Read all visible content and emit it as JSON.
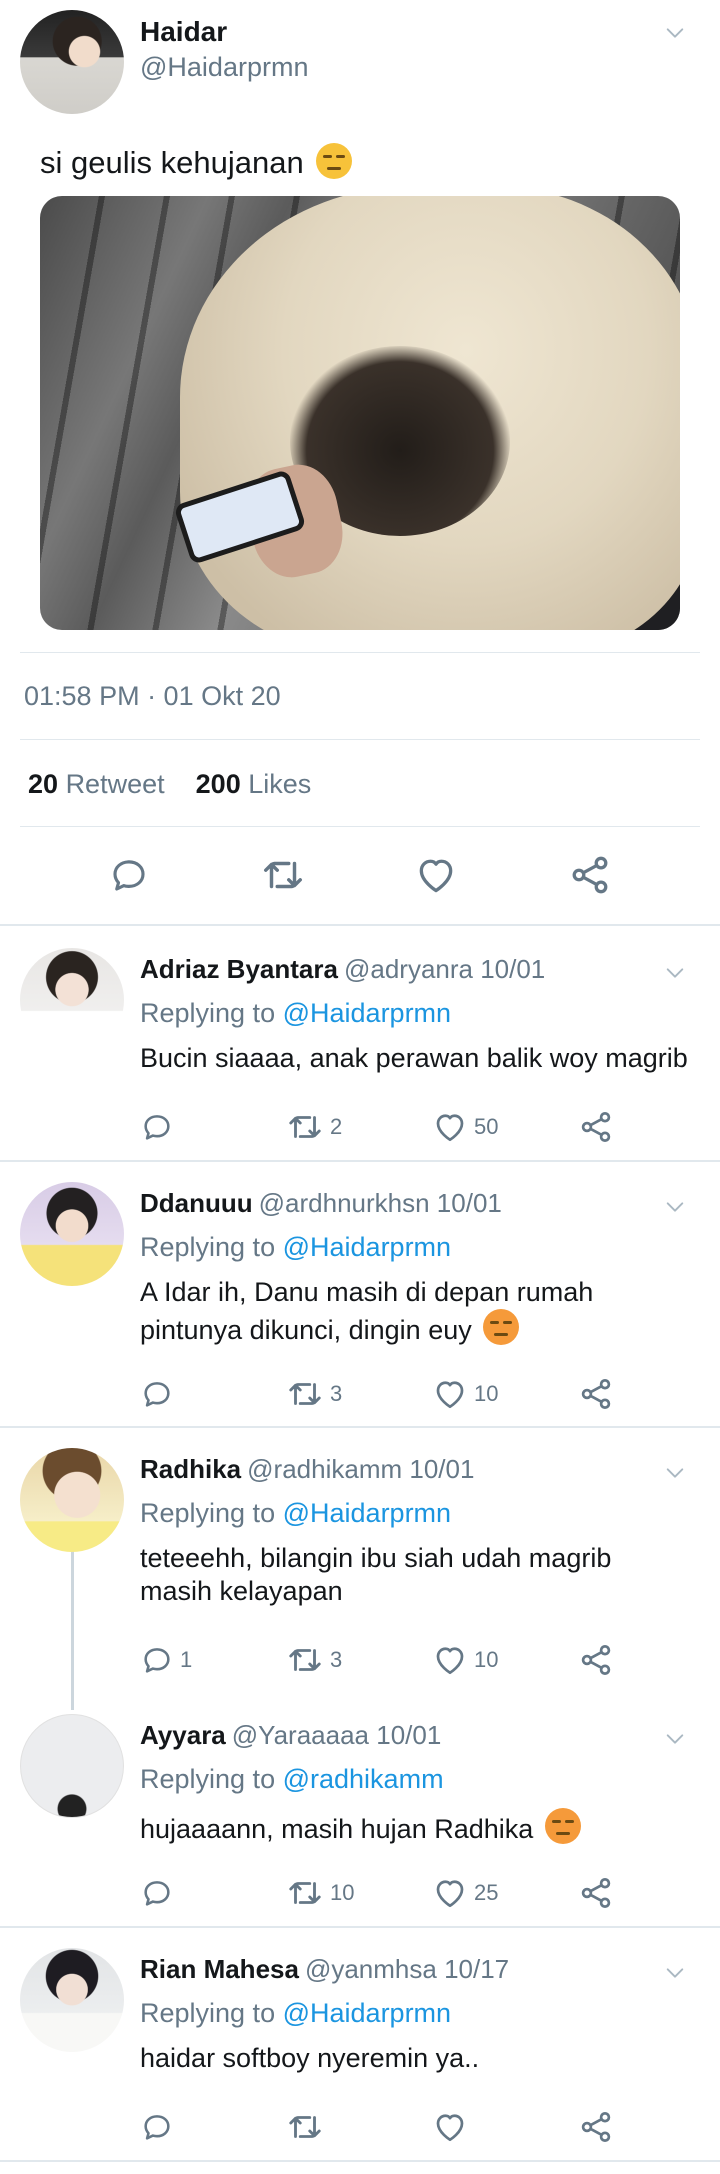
{
  "main_tweet": {
    "name": "Haidar",
    "handle": "@Haidarprmn",
    "text": "si geulis kehujanan",
    "timestamp": "01:58 PM · 01 Okt 20",
    "retweets": "20",
    "retweets_label": "Retweet",
    "likes": "200",
    "likes_label": "Likes"
  },
  "replies": [
    {
      "name": "Adriaz Byantara",
      "handle": "@adryanra 10/01",
      "replying_label": "Replying to",
      "replying_to": "@Haidarprmn",
      "text": "Bucin siaaaa, anak perawan balik woy magrib",
      "replies": "",
      "retweets": "2",
      "likes": "50"
    },
    {
      "name": "Ddanuuu",
      "handle": "@ardhnurkhsn 10/01",
      "replying_label": "Replying to",
      "replying_to": "@Haidarprmn",
      "text": "A Idar ih, Danu masih di depan rumah pintunya dikunci, dingin euy",
      "replies": "",
      "retweets": "3",
      "likes": "10"
    },
    {
      "name": "Radhika",
      "handle": "@radhikamm 10/01",
      "replying_label": "Replying to",
      "replying_to": "@Haidarprmn",
      "text": "teteeehh, bilangin ibu siah udah magrib masih kelayapan",
      "replies": "1",
      "retweets": "3",
      "likes": "10"
    },
    {
      "name": "Ayyara",
      "handle": "@Yaraaaaa 10/01",
      "replying_label": "Replying to",
      "replying_to": "@radhikamm",
      "text": "hujaaaann, masih hujan Radhika",
      "replies": "",
      "retweets": "10",
      "likes": "25"
    },
    {
      "name": "Rian Mahesa",
      "handle": "@yanmhsa 10/17",
      "replying_label": "Replying to",
      "replying_to": "@Haidarprmn",
      "text": "haidar softboy nyeremin ya..",
      "replies": "",
      "retweets": "",
      "likes": ""
    }
  ],
  "icons": {
    "reply": "reply-icon",
    "retweet": "retweet-icon",
    "like": "heart-icon",
    "share": "share-icon",
    "menu": "chevron-down-icon"
  },
  "colors": {
    "text": "#14171a",
    "muted": "#657786",
    "link": "#1b95e0",
    "divider": "#e1e8ed"
  }
}
